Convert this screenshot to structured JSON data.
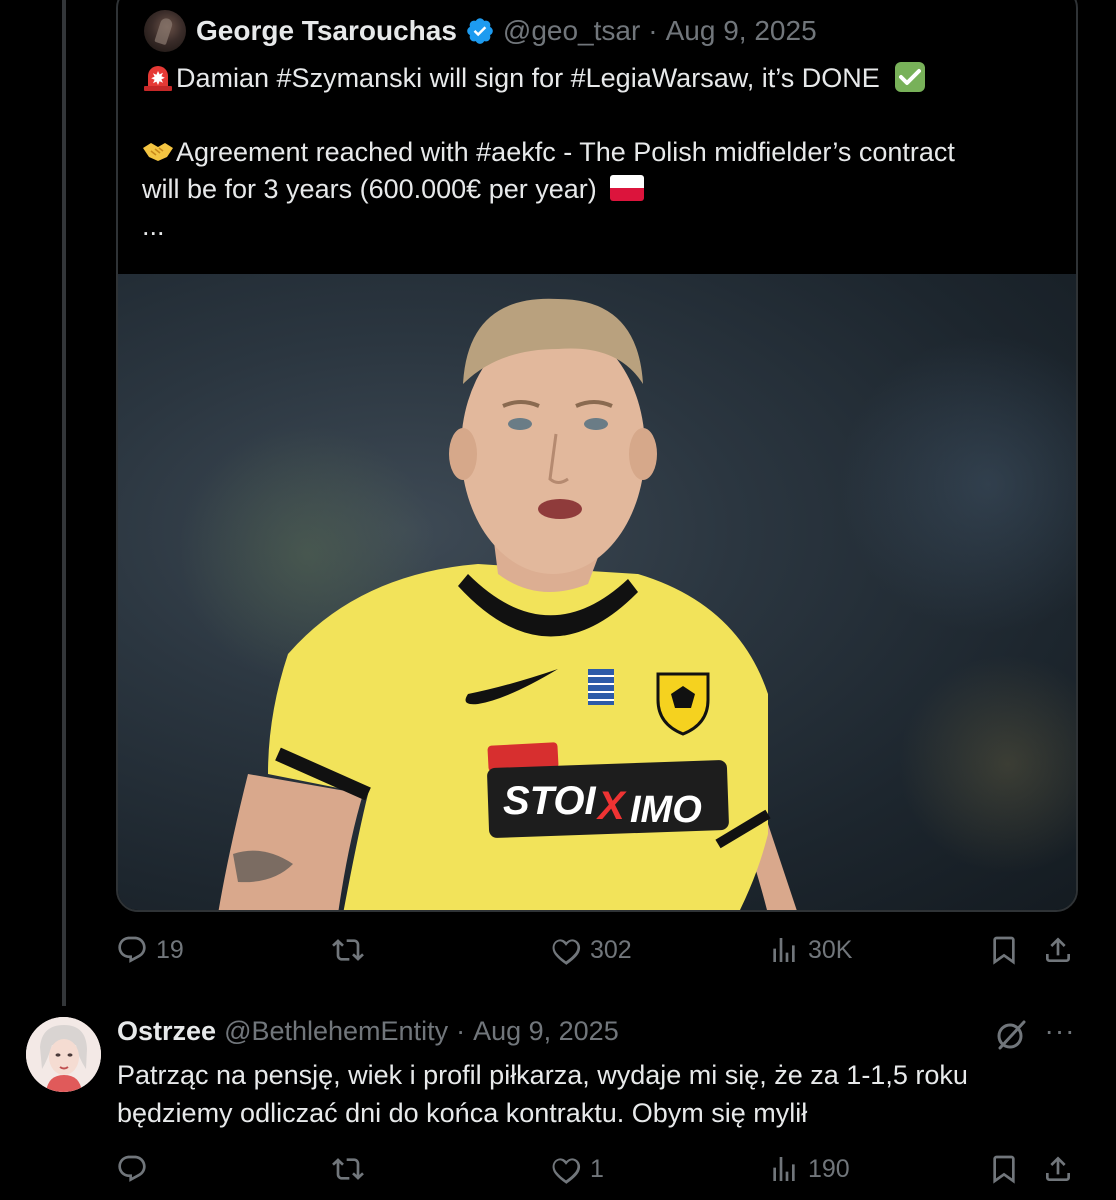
{
  "quoted_tweet": {
    "author_name": "George Tsarouchas",
    "handle": "@geo_tsar",
    "separator": "·",
    "date": "Aug 9, 2025",
    "line1": "Damian #Szymanski will sign for #LegiaWarsaw, it’s DONE",
    "line2": "Agreement reached with #aekfc - The Polish midfielder’s contract",
    "line3": "will be for 3 years (600.000€ per year)",
    "ellipsis": "...",
    "icons": [
      "siren-emoji",
      "check-emoji",
      "handshake-emoji",
      "poland-flag-emoji",
      "verified-badge-icon"
    ],
    "image_alt": "football player in yellow jersey"
  },
  "quoted_actions": {
    "replies": "19",
    "reposts": "",
    "likes": "302",
    "views": "30K"
  },
  "reply": {
    "author_name": "Ostrzee",
    "handle": "@BethlehemEntity",
    "separator": "·",
    "date": "Aug 9, 2025",
    "more": "···",
    "line1": "Patrząc na pensję, wiek i profil piłkarza, wydaje mi się, że za 1-1,5 roku",
    "line2": "będziemy odliczać dni do końca kontraktu. Obym się mylił"
  },
  "reply_actions": {
    "replies": "",
    "reposts": "",
    "likes": "1",
    "views": "190"
  },
  "colors": {
    "background": "#000000",
    "text": "#e7e9ea",
    "muted": "#71767b",
    "border": "#2f3336",
    "verified": "#1d9bf0"
  }
}
